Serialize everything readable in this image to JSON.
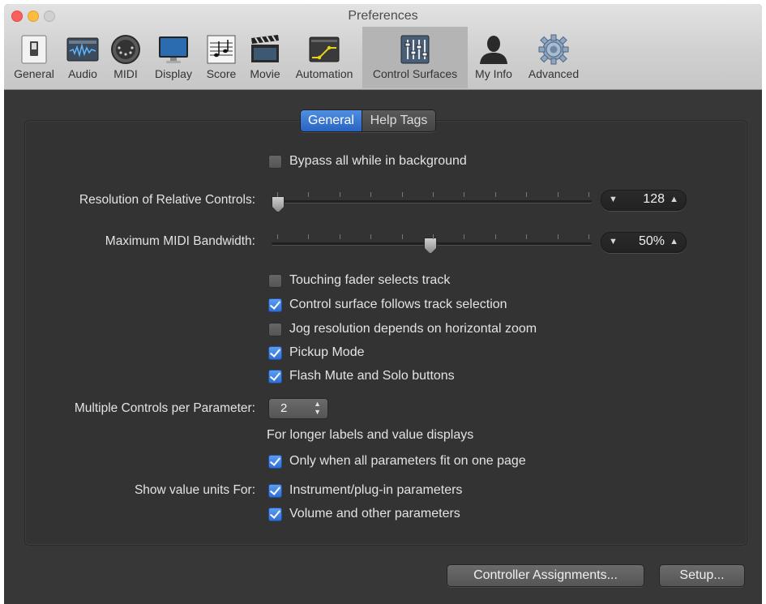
{
  "window": {
    "title": "Preferences"
  },
  "toolbar": {
    "items": [
      {
        "label": "General",
        "icon": "general-switch-icon"
      },
      {
        "label": "Audio",
        "icon": "audio-waveform-icon"
      },
      {
        "label": "MIDI",
        "icon": "midi-connector-icon"
      },
      {
        "label": "Display",
        "icon": "display-monitor-icon"
      },
      {
        "label": "Score",
        "icon": "score-notation-icon"
      },
      {
        "label": "Movie",
        "icon": "movie-clapper-icon"
      },
      {
        "label": "Automation",
        "icon": "automation-curve-icon"
      },
      {
        "label": "Control Surfaces",
        "icon": "mixer-faders-icon",
        "active": true
      },
      {
        "label": "My Info",
        "icon": "person-silhouette-icon"
      },
      {
        "label": "Advanced",
        "icon": "gear-icon"
      }
    ]
  },
  "tabs": {
    "general": "General",
    "help_tags": "Help Tags",
    "selected": "General"
  },
  "settings": {
    "bypass": {
      "label": "Bypass all while in background",
      "checked": false
    },
    "resolution": {
      "label": "Resolution of Relative Controls:",
      "value": "128",
      "slider_fraction": 0.0,
      "ticks": 11
    },
    "bandwidth": {
      "label": "Maximum MIDI Bandwidth:",
      "value": "50%",
      "slider_fraction": 0.5,
      "ticks": 11
    },
    "touching_fader": {
      "label": "Touching fader selects track",
      "checked": false
    },
    "follows_selection": {
      "label": "Control surface follows track selection",
      "checked": true
    },
    "jog_resolution": {
      "label": "Jog resolution depends on horizontal zoom",
      "checked": false
    },
    "pickup_mode": {
      "label": "Pickup Mode",
      "checked": true
    },
    "flash_mute": {
      "label": "Flash Mute and Solo buttons",
      "checked": true
    },
    "multiple_controls": {
      "label": "Multiple Controls per Parameter:",
      "value": "2"
    },
    "longer_labels": {
      "label": "For longer labels and value displays"
    },
    "only_when_fit": {
      "label": "Only when all parameters fit on one page",
      "checked": true
    },
    "show_units": {
      "label": "Show value units For:"
    },
    "instrument_params": {
      "label": "Instrument/plug-in parameters",
      "checked": true
    },
    "volume_params": {
      "label": "Volume and other parameters",
      "checked": true
    }
  },
  "buttons": {
    "controller_assignments": "Controller Assignments...",
    "setup": "Setup..."
  },
  "colors": {
    "accent": "#2f6fd8",
    "background": "#373737",
    "toolbar": "#cfcfcf"
  }
}
